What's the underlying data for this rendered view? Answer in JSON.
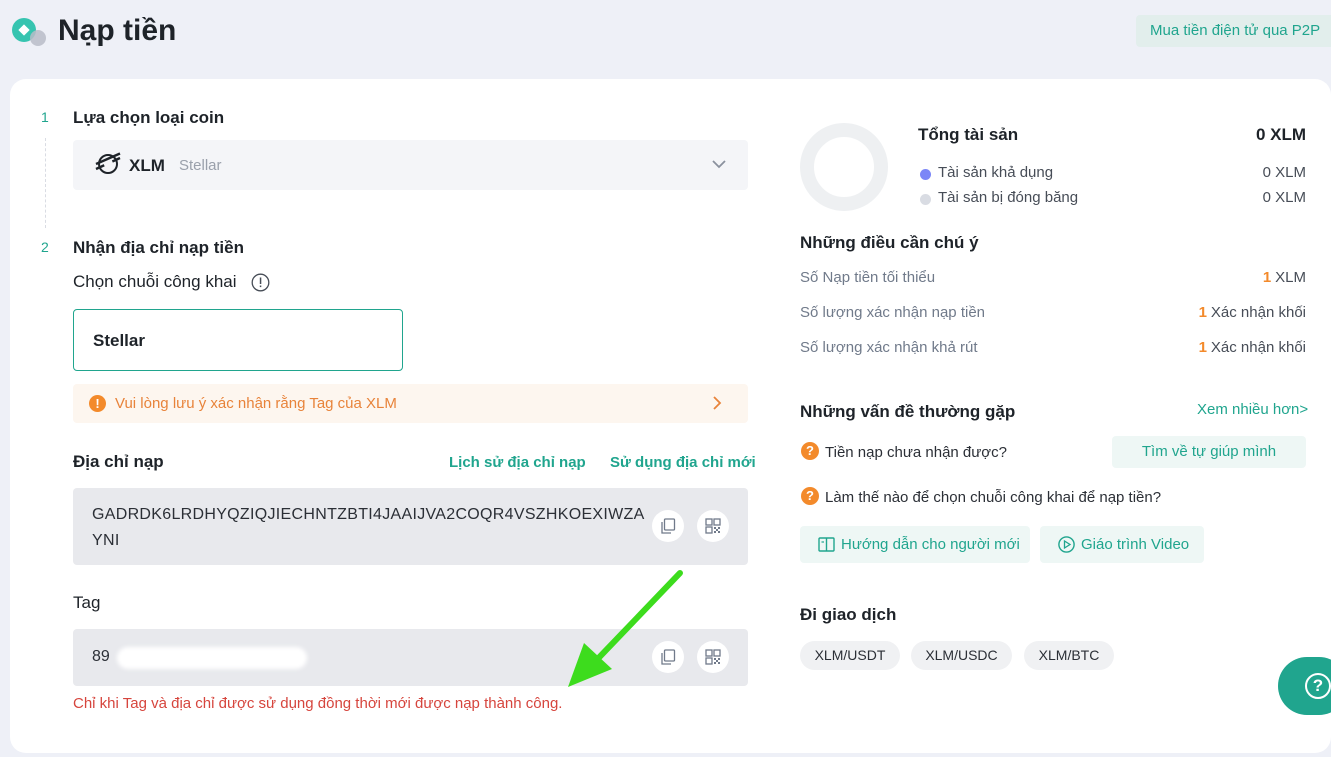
{
  "header": {
    "title": "Nạp tiền",
    "p2p_button": "Mua tiền điện tử qua P2P"
  },
  "step1": {
    "number": "1",
    "title": "Lựa chọn loại coin",
    "coin_symbol": "XLM",
    "coin_name": "Stellar"
  },
  "step2": {
    "number": "2",
    "title": "Nhận địa chỉ nạp tiền",
    "chain_label": "Chọn chuỗi công khai",
    "chain_value": "Stellar",
    "warning": "Vui lòng lưu ý xác nhận rằng Tag của XLM",
    "address_label": "Địa chỉ nạp",
    "address_history_link": "Lịch sử địa chỉ nạp",
    "new_address_link": "Sử dụng địa chỉ mới",
    "address_value": "GADRDK6LRDHYQZIQJIECHNTZBTI4JAAIJVA2COQR4VSZHKOEXIWZAYNI",
    "tag_label": "Tag",
    "tag_value": "89",
    "tag_note": "Chỉ khi Tag và địa chỉ được sử dụng đồng thời mới được nạp thành công."
  },
  "assets": {
    "title": "Tổng tài sản",
    "total": "0 XLM",
    "available_label": "Tài sản khả dụng",
    "available_value": "0 XLM",
    "frozen_label": "Tài sản bị đóng băng",
    "frozen_value": "0 XLM",
    "available_color": "#7b86f7",
    "frozen_color": "#d9dce3"
  },
  "notes": {
    "title": "Những điều cần chú ý",
    "min_label": "Số Nạp tiền tối thiểu",
    "min_num": "1",
    "min_unit": "XLM",
    "confirm_label": "Số lượng xác nhận nạp tiền",
    "confirm_num": "1",
    "confirm_unit": "Xác nhận khối",
    "withdraw_label": "Số lượng xác nhận khả rút",
    "withdraw_num": "1",
    "withdraw_unit": "Xác nhận khối"
  },
  "faq": {
    "title": "Những vấn đề thường gặp",
    "more_link": "Xem nhiều hơn>",
    "q1": "Tiền nạp chưa nhận được?",
    "help_button": "Tìm về tự giúp mình",
    "q2": "Làm thế nào để chọn chuỗi công khai để nạp tiền?",
    "guide_button": "Hướng dẫn cho người mới",
    "video_button": "Giáo trình Video"
  },
  "trade": {
    "title": "Đi giao dịch",
    "pairs": [
      "XLM/USDT",
      "XLM/USDC",
      "XLM/BTC"
    ]
  },
  "colors": {
    "accent": "#20a58e",
    "warning": "#f38a2b",
    "error": "#d6453d",
    "annotation_arrow": "#3ddc1d"
  }
}
